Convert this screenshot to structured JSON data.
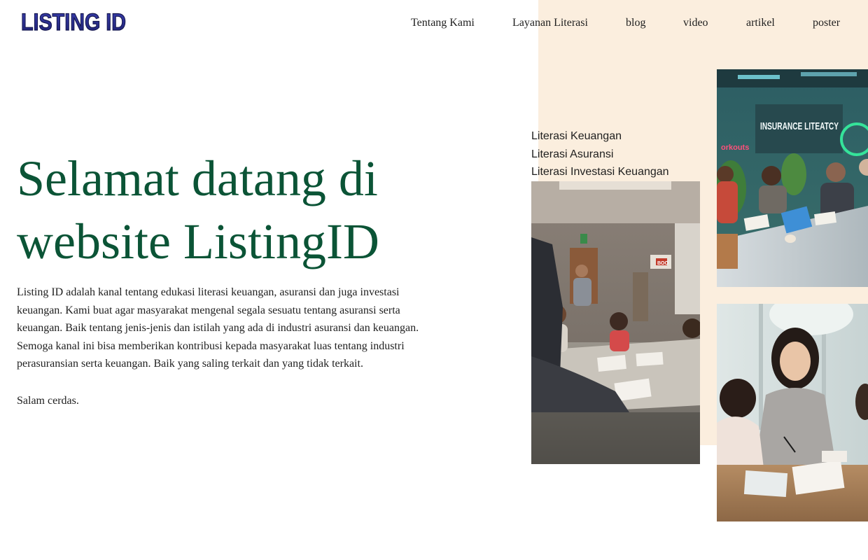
{
  "brand": {
    "logo_text": "LISTING ID"
  },
  "nav": {
    "items": [
      {
        "label": "Tentang Kami"
      },
      {
        "label": "Layanan Literasi"
      },
      {
        "label": "blog"
      },
      {
        "label": "video"
      },
      {
        "label": "artikel"
      },
      {
        "label": "poster"
      }
    ]
  },
  "hero": {
    "title": "Selamat datang di website ListingID",
    "body": "Listing ID adalah kanal tentang edukasi literasi keuangan, asuransi dan juga investasi keuangan. Kami buat agar masyarakat mengenal segala sesuatu tentang asuransi serta keuangan. Baik tentang jenis-jenis dan istilah yang ada di industri asuransi dan keuangan. Semoga kanal ini bisa memberikan kontribusi kepada masyarakat luas tentang industri perasuransian serta keuangan. Baik yang saling terkait dan yang tidak terkait.",
    "sign_off": "Salam cerdas."
  },
  "literacy_links": [
    {
      "label": "Literasi Keuangan"
    },
    {
      "label": "Literasi Asuransi"
    },
    {
      "label": "Literasi Investasi Keuangan"
    }
  ],
  "photos": {
    "office_sign_text": "INSURANCE LITEATCY",
    "office_side_text": "orkouts",
    "classroom_sign_text": "BOO"
  },
  "colors": {
    "heading_green": "#0b5436",
    "peach_background": "#fbeede",
    "logo_navy": "#2b2f8f"
  }
}
